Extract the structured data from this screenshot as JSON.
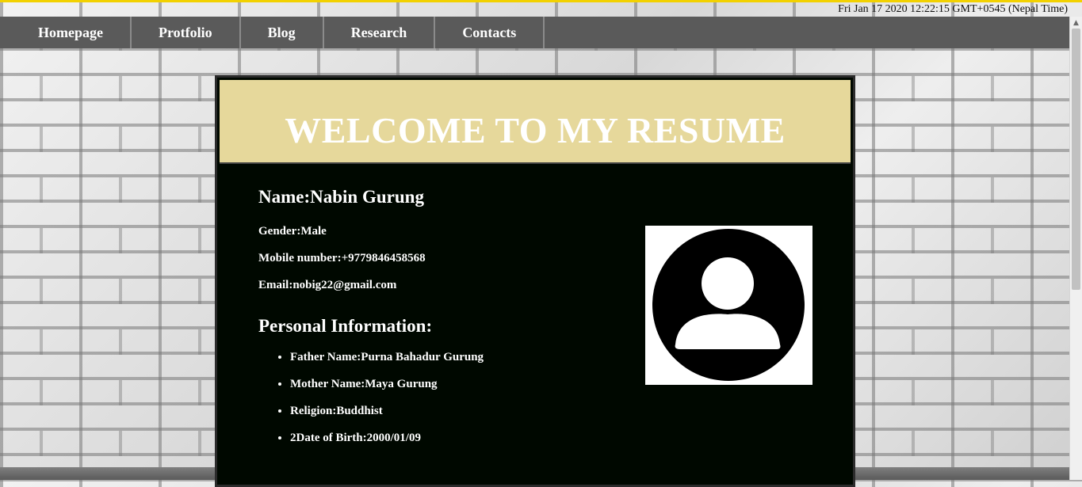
{
  "clock": {
    "text": "Fri Jan 17 2020 12:22:15 GMT+0545 (Nepal Time)"
  },
  "nav": {
    "items": [
      "Homepage",
      "Protfolio",
      "Blog",
      "Research",
      "Contacts"
    ]
  },
  "resume": {
    "title": "WELCOME TO MY RESUME",
    "name": "Name:Nabin Gurung",
    "gender": "Gender:Male",
    "mobile": "Mobile number:+9779846458568",
    "email": "Email:nobig22@gmail.com",
    "personal_title": "Personal Information:",
    "personal_items": [
      "Father Name:Purna Bahadur Gurung",
      "Mother Name:Maya Gurung",
      "Religion:Buddhist",
      "2Date of Birth:2000/01/09"
    ]
  },
  "colors": {
    "header_bg": "#e6d89b",
    "panel_bg": "#000800",
    "nav_bg": "#5a5a5a",
    "top_accent": "#f2d100"
  },
  "icons": {
    "avatar": "user-avatar-icon",
    "scroll_up": "chevron-up-icon"
  }
}
